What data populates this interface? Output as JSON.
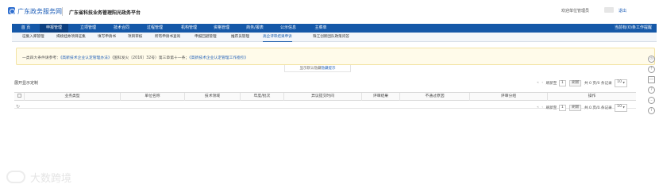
{
  "header": {
    "logo_text": "广东政务服务网",
    "platform_title": "广东省科技业务管理阳光政务平台",
    "welcome": "欢迎单位管理员",
    "logout": "退出"
  },
  "nav": {
    "items": [
      {
        "label": "首 页"
      },
      {
        "label": "申报管理"
      },
      {
        "label": "立项管理"
      },
      {
        "label": "技术合同"
      },
      {
        "label": "过程管理"
      },
      {
        "label": "机构管理"
      },
      {
        "label": "资格管理"
      },
      {
        "label": "商务/报表"
      },
      {
        "label": "公示信息"
      },
      {
        "label": "主菜单"
      }
    ],
    "right_text": "当前有(0)条工作提醒"
  },
  "subnav": {
    "items": [
      {
        "label": "征集入库管理"
      },
      {
        "label": "揭榜挂帅项目征集"
      },
      {
        "label": "填写申请书"
      },
      {
        "label": "项目审核"
      },
      {
        "label": "所有申请书查询"
      },
      {
        "label": "申报回避管理"
      },
      {
        "label": "推荐员管理"
      },
      {
        "label": "高企评审结果申诉"
      },
      {
        "label": "珠江创新团队政策问答"
      }
    ]
  },
  "notice": {
    "prefix": "一类四大条件请参考：",
    "link1": "《高新技术企业认定管理办法》",
    "middle": "（国科发火〔2016〕32号）第三章第十一条；",
    "link2": "《高新技术企业认定管理工作指引》",
    "toggle_prefix": "显示默认隐藏",
    "toggle_link": "隐藏提示"
  },
  "toolbar": {
    "select_label": "展开显示定制",
    "pager_top": {
      "refresh": "刷新至",
      "page": "1",
      "go": "刷新",
      "total": "共 0 页/0 条记录",
      "size": "10"
    },
    "pager_bottom": {
      "refresh": "刷新至",
      "page": "1",
      "go": "刷新",
      "total": "共 0 页/0 条记录",
      "size": "10"
    }
  },
  "table": {
    "columns": [
      "",
      "业务类型",
      "单位名称",
      "技术领域",
      "年度/批次",
      "异议提交时间",
      "评审结果",
      "不通过原因",
      "评审分组",
      "操作"
    ]
  },
  "watermark": "大数跨境"
}
